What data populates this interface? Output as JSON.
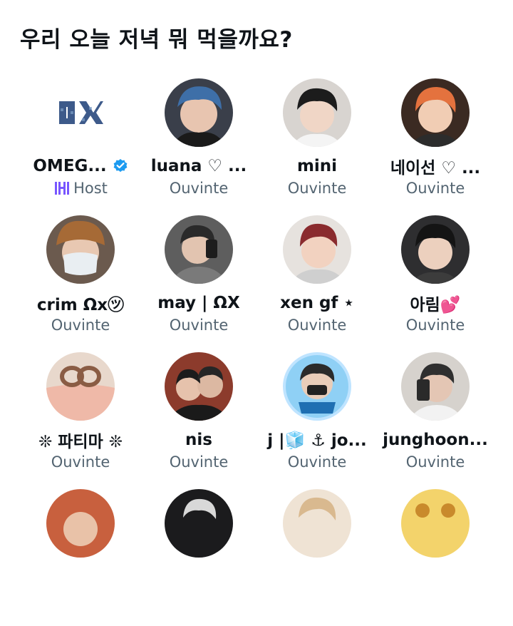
{
  "space": {
    "title": "우리 오늘 저녁 뭐 먹을까요?"
  },
  "accent": "#1d9bf0",
  "host_color": "#7856ff",
  "participants": [
    {
      "name": "OMEG...",
      "role": "Host",
      "verified": true,
      "avatar": "logo-omega"
    },
    {
      "name": "luana ♡ ...",
      "role": "Ouvinte"
    },
    {
      "name": "mini",
      "role": "Ouvinte"
    },
    {
      "name": "네이선 ♡ ...",
      "role": "Ouvinte"
    },
    {
      "name": "crim Ωx㋡",
      "role": "Ouvinte"
    },
    {
      "name": "may | ΩX",
      "role": "Ouvinte"
    },
    {
      "name": "xen gf ⋆",
      "role": "Ouvinte"
    },
    {
      "name": "아림💕",
      "role": "Ouvinte"
    },
    {
      "name": "❊ 파티마 ❊",
      "role": "Ouvinte"
    },
    {
      "name": "nis",
      "role": "Ouvinte"
    },
    {
      "name": "j |🧊 ⚓ jo...",
      "role": "Ouvinte"
    },
    {
      "name": "junghoon...",
      "role": "Ouvinte"
    },
    {
      "name": "",
      "role": ""
    },
    {
      "name": "",
      "role": ""
    },
    {
      "name": "",
      "role": ""
    },
    {
      "name": "",
      "role": ""
    }
  ]
}
